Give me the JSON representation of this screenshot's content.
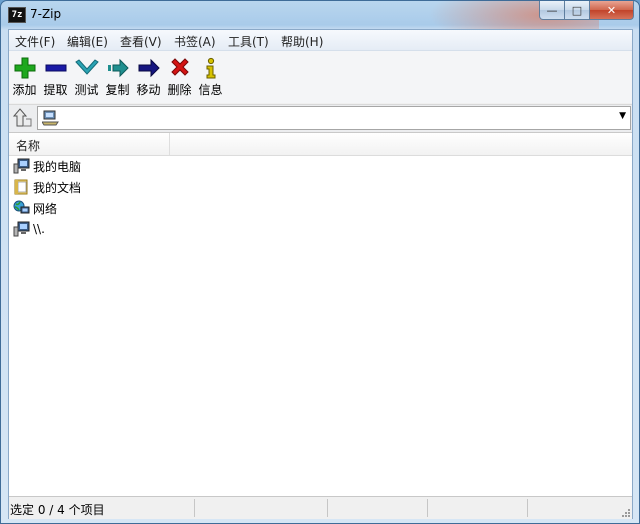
{
  "window": {
    "title": "7-Zip",
    "app_icon_text": "7z"
  },
  "caption": {
    "minimize": "—",
    "maximize": "□",
    "close": "✕"
  },
  "menu": [
    {
      "label": "文件(F)"
    },
    {
      "label": "编辑(E)"
    },
    {
      "label": "查看(V)"
    },
    {
      "label": "书签(A)"
    },
    {
      "label": "工具(T)"
    },
    {
      "label": "帮助(H)"
    }
  ],
  "toolbar": [
    {
      "label": "添加",
      "icon": "plus-icon",
      "color": "#1ea81e"
    },
    {
      "label": "提取",
      "icon": "minus-icon",
      "color": "#1a1aa6"
    },
    {
      "label": "测试",
      "icon": "checkmark-icon",
      "color": "#2aa3b4"
    },
    {
      "label": "复制",
      "icon": "copy-arrow-icon",
      "color": "#1f8f8f"
    },
    {
      "label": "移动",
      "icon": "move-arrow-icon",
      "color": "#161680"
    },
    {
      "label": "删除",
      "icon": "delete-x-icon",
      "color": "#d41414"
    },
    {
      "label": "信息",
      "icon": "info-icon",
      "color": "#d6c200"
    }
  ],
  "address": {
    "value": "",
    "icon": "computer-drive-icon"
  },
  "list": {
    "columns": [
      {
        "label": "名称"
      }
    ],
    "items": [
      {
        "name": "我的电脑",
        "icon": "computer-icon"
      },
      {
        "name": "我的文档",
        "icon": "documents-folder-icon"
      },
      {
        "name": "网络",
        "icon": "network-icon"
      },
      {
        "name": "\\\\.",
        "icon": "computer-icon"
      }
    ]
  },
  "status": {
    "text": "选定 0 / 4 个项目"
  }
}
